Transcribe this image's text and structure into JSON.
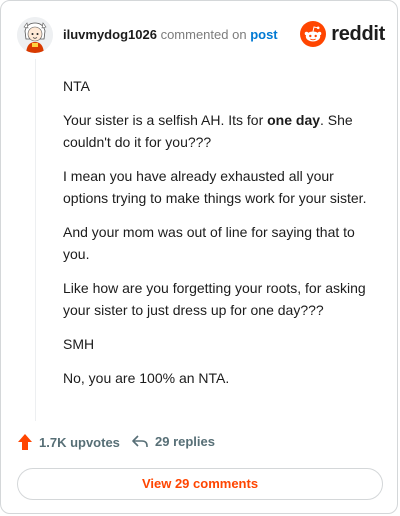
{
  "header": {
    "username": "iluvmydog1026",
    "commented_text": "commented on",
    "post_link": "post",
    "brand": "reddit"
  },
  "comment": {
    "paragraphs": [
      {
        "text": "NTA"
      },
      {
        "before": "Your sister is a selfish AH. Its for ",
        "bold": "one day",
        "after": ". She couldn't do it for you???"
      },
      {
        "text": "I mean you have already exhausted all your options trying to make things work for your sister."
      },
      {
        "text": "And your mom was out of line for saying that to you."
      },
      {
        "text": "Like how are you forgetting your roots, for asking your sister to just dress up for one day???"
      },
      {
        "text": "SMH"
      },
      {
        "text": "No, you are 100% an NTA."
      }
    ]
  },
  "footer": {
    "upvotes": "1.7K upvotes",
    "replies": "29 replies",
    "view_button": "View 29 comments"
  },
  "colors": {
    "brand_orange": "#ff4500",
    "link_blue": "#0079d3",
    "muted": "#576f76"
  },
  "icons": [
    "avatar",
    "reddit-logo-icon",
    "upvote-arrow-icon",
    "reply-arrow-icon"
  ]
}
